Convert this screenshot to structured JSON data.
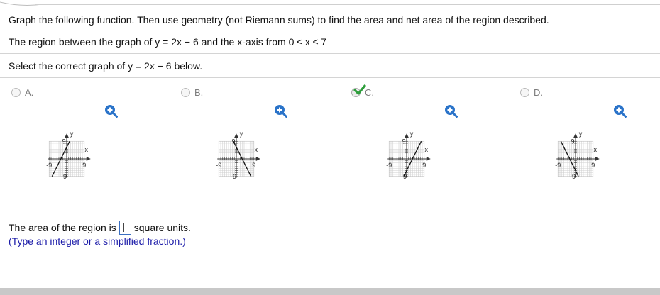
{
  "question": {
    "instruction": "Graph the following function. Then use geometry (not Riemann sums) to find the area and net area of the region described.",
    "region": "The region between the graph of y = 2x − 6 and the x-axis from 0 ≤ x ≤ 7",
    "prompt": "Select the correct graph of y = 2x − 6 below."
  },
  "choices": [
    {
      "letter": "A.",
      "selected": false,
      "slope": 2,
      "intercept": 6
    },
    {
      "letter": "B.",
      "selected": false,
      "slope": -2,
      "intercept": 6
    },
    {
      "letter": "C.",
      "selected": true,
      "slope": 2,
      "intercept": -6
    },
    {
      "letter": "D.",
      "selected": false,
      "slope": -2,
      "intercept": -6
    }
  ],
  "graph": {
    "x_label": "x",
    "y_label": "y",
    "x_min_label": "-9",
    "x_max_label": "9",
    "y_max_label": "9",
    "y_min_label": "-9",
    "range": [
      -9,
      9
    ]
  },
  "answer": {
    "prefix": "The area of the region is",
    "suffix": "square units.",
    "value": "",
    "hint": "(Type an integer or a simplified fraction.)"
  },
  "colors": {
    "check": "#2e9e3c",
    "zoom": "#2a73c9",
    "hint": "#1a1aa8",
    "input_border": "#3b6fc1"
  }
}
